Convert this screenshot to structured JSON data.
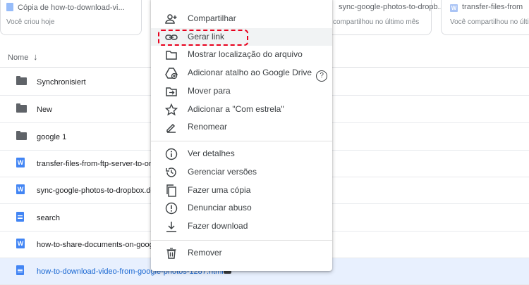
{
  "cards": [
    {
      "title": "Cópia de how-to-download-vi...",
      "subtitle": "Você criou hoje",
      "icon": "gdoc-icon"
    },
    {
      "title": "sync-google-photos-to-dropb...",
      "subtitle": "compartilhou no último mês",
      "icon": "word-icon"
    },
    {
      "title": "transfer-files-from",
      "subtitle": "Você compartilhou no último mês",
      "icon": "word-icon"
    }
  ],
  "list_header": {
    "name_label": "Nome",
    "sort_arrow": "↓"
  },
  "rows": [
    {
      "name": "Synchronisiert",
      "type": "folder-shared"
    },
    {
      "name": "New",
      "type": "folder"
    },
    {
      "name": "google 1",
      "type": "folder"
    },
    {
      "name": "transfer-files-from-ftp-server-to-on",
      "type": "word"
    },
    {
      "name": "sync-google-photos-to-dropbox.doc",
      "type": "word"
    },
    {
      "name": "search",
      "type": "gdoc"
    },
    {
      "name": "how-to-share-documents-on-googl",
      "type": "word"
    },
    {
      "name": "how-to-download-video-from-google-photos-1287.html",
      "type": "gdoc"
    }
  ],
  "menu": {
    "items": [
      {
        "label": "Compartilhar",
        "icon": "person-add-icon"
      },
      {
        "label": "Gerar link",
        "icon": "link-icon"
      },
      {
        "label": "Mostrar localização do arquivo",
        "icon": "folder-outline-icon"
      },
      {
        "label": "Adicionar atalho ao Google Drive",
        "icon": "drive-shortcut-icon"
      },
      {
        "label": "Mover para",
        "icon": "move-to-icon"
      },
      {
        "label": "Adicionar a \"Com estrela\"",
        "icon": "star-icon"
      },
      {
        "label": "Renomear",
        "icon": "pencil-icon"
      },
      {
        "label": "Ver detalhes",
        "icon": "info-icon"
      },
      {
        "label": "Gerenciar versões",
        "icon": "history-icon"
      },
      {
        "label": "Fazer uma cópia",
        "icon": "copy-icon"
      },
      {
        "label": "Denunciar abuso",
        "icon": "report-icon"
      },
      {
        "label": "Fazer download",
        "icon": "download-icon"
      },
      {
        "label": "Remover",
        "icon": "trash-icon"
      }
    ],
    "help_glyph": "?"
  },
  "colors": {
    "highlight_border": "#e8001c",
    "selected_row_bg": "#e8f0fe",
    "accent_blue": "#4285f4"
  }
}
